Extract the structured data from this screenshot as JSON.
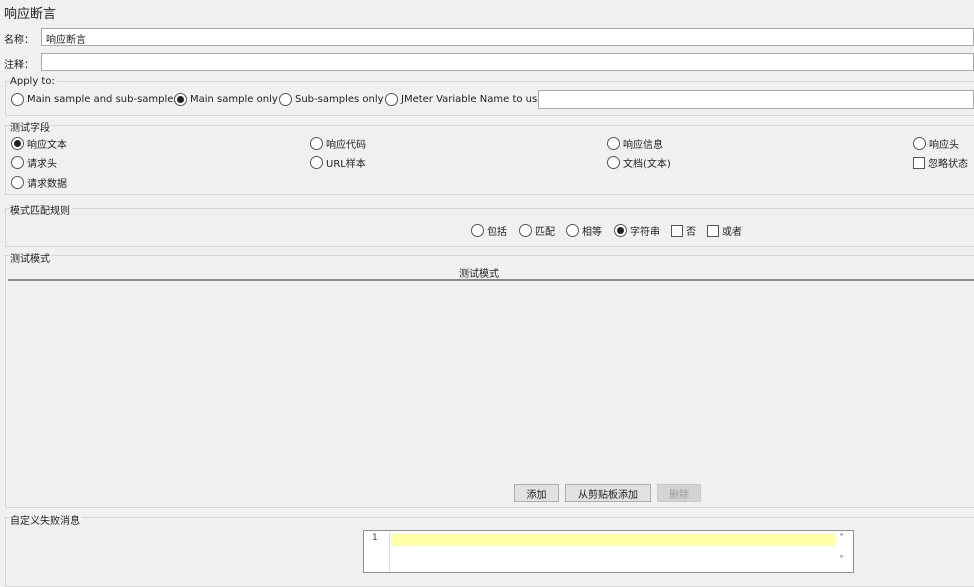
{
  "title": "响应断言",
  "name": {
    "label": "名称：",
    "value": "响应断言"
  },
  "comment": {
    "label": "注释：",
    "value": ""
  },
  "apply_to": {
    "legend": "Apply to:",
    "options": [
      "Main sample and sub-samples",
      "Main sample only",
      "Sub-samples only",
      "JMeter Variable Name to use"
    ],
    "selected": "Main sample only",
    "variable_value": ""
  },
  "test_field": {
    "legend": "测试字段",
    "options": [
      "响应文本",
      "响应代码",
      "响应信息",
      "响应头",
      "请求头",
      "URL样本",
      "文档(文本)",
      "请求数据"
    ],
    "selected": "响应文本",
    "ignore_status": {
      "label": "忽略状态",
      "checked": false
    }
  },
  "pattern_rules": {
    "legend": "模式匹配规则",
    "options": [
      "包括",
      "匹配",
      "相等",
      "字符串"
    ],
    "selected": "字符串",
    "not": {
      "label": "否",
      "checked": false
    },
    "or": {
      "label": "或者",
      "checked": false
    }
  },
  "patterns": {
    "legend": "测试模式",
    "column": "测试模式",
    "rows": [],
    "add": "添加",
    "add_clipboard": "从剪贴板添加",
    "delete": "删除"
  },
  "failure_message": {
    "label": "自定义失败消息",
    "line_number": "1",
    "value": ""
  },
  "colors": {
    "highlight_line": "#ffffa8"
  }
}
